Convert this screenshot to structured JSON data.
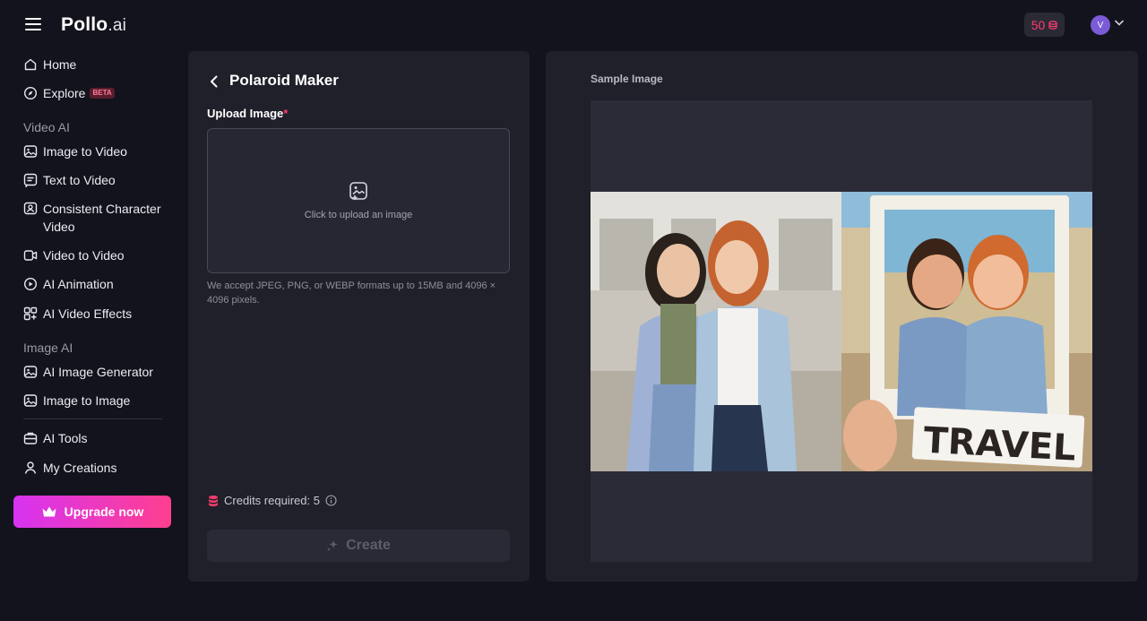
{
  "header": {
    "logo_main": "Pollo",
    "logo_suffix": ".ai",
    "credits": "50",
    "avatar_initial": "V"
  },
  "sidebar": {
    "items": [
      {
        "label": "Home",
        "icon": "home-icon"
      },
      {
        "label": "Explore",
        "badge": "BETA",
        "icon": "compass-icon"
      },
      {
        "label": "Image to Video",
        "icon": "image-video-icon"
      },
      {
        "label": "Text to Video",
        "icon": "text-video-icon"
      },
      {
        "label": "Consistent Character Video",
        "icon": "character-icon"
      },
      {
        "label": "Video to Video",
        "icon": "video-video-icon"
      },
      {
        "label": "AI Animation",
        "icon": "animation-icon"
      },
      {
        "label": "AI Video Effects",
        "icon": "effects-icon"
      },
      {
        "label": "AI Image Generator",
        "icon": "image-gen-icon"
      },
      {
        "label": "Image to Image",
        "icon": "image-image-icon"
      },
      {
        "label": "AI Tools",
        "icon": "tools-icon"
      },
      {
        "label": "My Creations",
        "icon": "creations-icon"
      }
    ],
    "sections": {
      "video": "Video AI",
      "image": "Image AI"
    },
    "upgrade_label": "Upgrade now"
  },
  "tool_panel": {
    "title": "Polaroid Maker",
    "upload_label": "Upload Image",
    "required_mark": "*",
    "upload_hint": "Click to upload an image",
    "formats_note": "We accept JPEG, PNG, or WEBP formats up to 15MB and 4096 × 4096 pixels.",
    "credits_label": "Credits required: 5",
    "create_label": "Create"
  },
  "sample_panel": {
    "title": "Sample Image",
    "overlay_text": "TRAVEL"
  },
  "colors": {
    "background": "#13131d",
    "panel": "#20202b",
    "accent_pink": "#ff3d6e",
    "upgrade_gradient_start": "#d733f2",
    "upgrade_gradient_end": "#ff3f8e"
  }
}
